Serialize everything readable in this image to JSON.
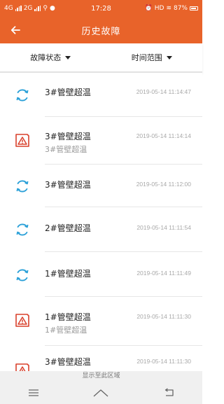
{
  "status_bar": {
    "net_left": "4G",
    "net_mid": "2G",
    "time": "17:28",
    "hd": "HD",
    "battery": "87%"
  },
  "header": {
    "title": "历史故障"
  },
  "filters": {
    "status_label": "故障状态",
    "range_label": "时间范围"
  },
  "colors": {
    "accent": "#e8632a",
    "recover_icon": "#2aa0d8",
    "alarm_icon": "#d9402c"
  },
  "records": [
    {
      "icon": "recover-icon",
      "title": "3#管壁超温",
      "sub": "",
      "time": "2019-05-14 11:14:47"
    },
    {
      "icon": "alarm-icon",
      "title": "3#管壁超温",
      "sub": "3#管壁超温",
      "time": "2019-05-14 11:14:14"
    },
    {
      "icon": "recover-icon",
      "title": "3#管壁超温",
      "sub": "",
      "time": "2019-05-14 11:12:00"
    },
    {
      "icon": "recover-icon",
      "title": "2#管壁超温",
      "sub": "",
      "time": "2019-05-14 11:11:54"
    },
    {
      "icon": "recover-icon",
      "title": "1#管壁超温",
      "sub": "",
      "time": "2019-05-14 11:11:49"
    },
    {
      "icon": "alarm-icon",
      "title": "1#管壁超温",
      "sub": "1#管壁超温",
      "time": "2019-05-14 11:11:30"
    },
    {
      "icon": "alarm-icon",
      "title": "3#管壁超温",
      "sub": "",
      "time": "2019-05-14 11:11:30"
    }
  ],
  "banner": {
    "text": "显示至此区域"
  }
}
